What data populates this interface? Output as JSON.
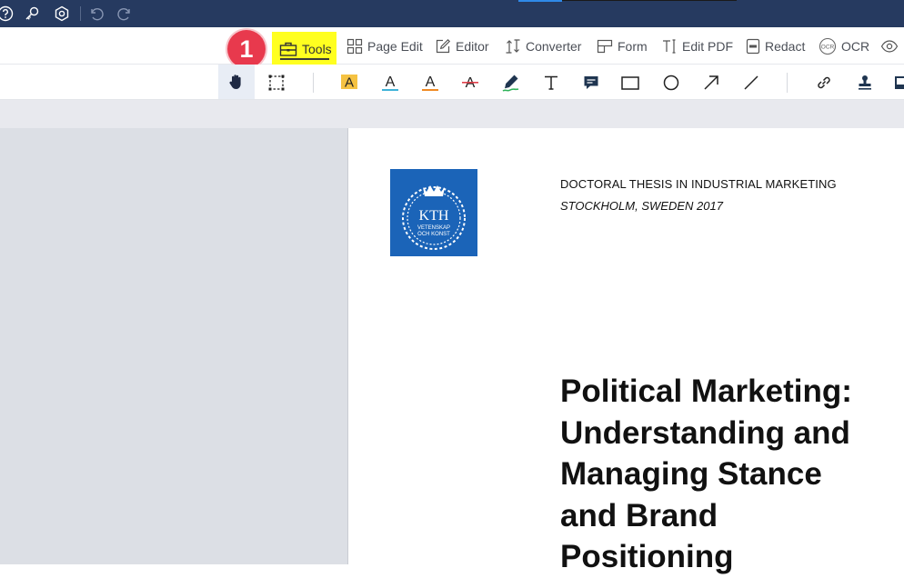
{
  "titlebar": {
    "icons": [
      "help-icon",
      "key-icon",
      "settings-icon",
      "undo-icon",
      "redo-icon"
    ]
  },
  "menubar": {
    "step_badge": "1",
    "items": [
      {
        "label": "Tools",
        "icon": "toolbox-icon",
        "active": true
      },
      {
        "label": "Page Edit",
        "icon": "grid-icon"
      },
      {
        "label": "Editor",
        "icon": "edit-icon"
      },
      {
        "label": "Converter",
        "icon": "convert-icon"
      },
      {
        "label": "Form",
        "icon": "form-icon"
      },
      {
        "label": "Edit PDF",
        "icon": "text-cursor-icon"
      },
      {
        "label": "Redact",
        "icon": "redact-icon"
      },
      {
        "label": "OCR",
        "icon": "ocr-icon"
      }
    ]
  },
  "toolbar": {
    "tools": [
      "hand-icon",
      "marquee-select-icon",
      "highlight-text-icon",
      "underline-text-icon",
      "squiggly-text-icon",
      "strikethrough-text-icon",
      "pen-icon",
      "text-box-icon",
      "comment-icon",
      "rectangle-icon",
      "ellipse-icon",
      "arrow-icon",
      "line-icon",
      "link-icon",
      "stamp-icon",
      "image-icon"
    ]
  },
  "document": {
    "logo_text_main": "KTH",
    "logo_text_line1": "VETENSKAP",
    "logo_text_line2": "OCH KONST",
    "thesis_type": "DOCTORAL THESIS IN INDUSTRIAL MARKETING",
    "thesis_place": "STOCKHOLM, SWEDEN 2017",
    "title_lines": [
      "Political Marketing:",
      "Understanding and",
      "Managing Stance",
      "and Brand",
      "Positioning"
    ]
  },
  "colors": {
    "titlebar": "#263a60",
    "highlight": "#ffff20",
    "badge": "#e8394d",
    "kth_blue": "#1b64b8"
  }
}
